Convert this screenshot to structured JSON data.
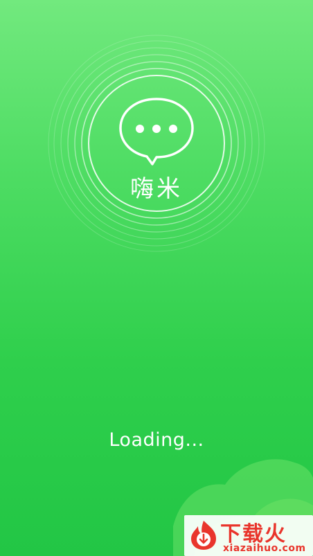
{
  "app": {
    "name": "嗨米"
  },
  "status": {
    "loading_text": "Loading..."
  },
  "icons": {
    "logo": "chat-bubble-dots-icon",
    "watermark_logo": "flame-download-icon"
  },
  "watermark": {
    "title": "下载火",
    "url": "xiazaihuo.com"
  },
  "colors": {
    "background_top": "#72e97e",
    "background_bottom": "#22c645",
    "foreground": "#ffffff",
    "watermark_accent": "#e9352c"
  }
}
